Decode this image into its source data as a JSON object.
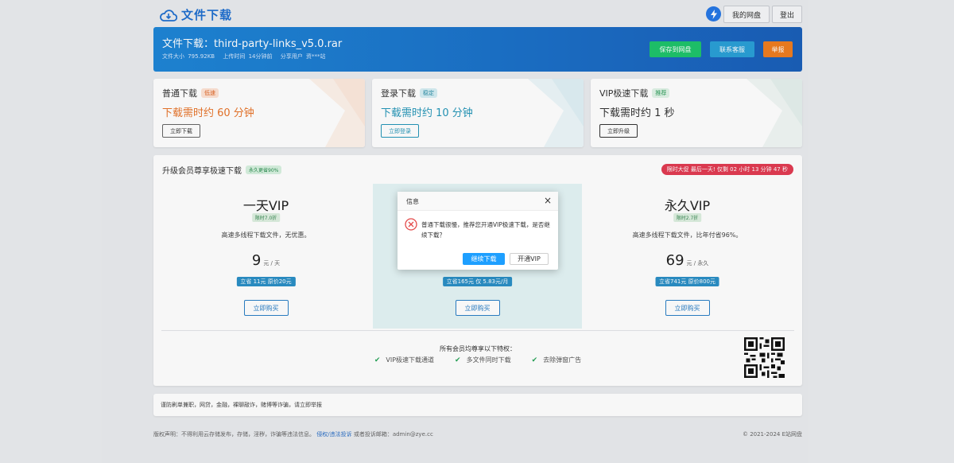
{
  "header": {
    "logo_text": "文件下载",
    "my_pan_label": "我的网盘",
    "logout_label": "登出"
  },
  "banner": {
    "title": "文件下载：third-party-links_v5.0.rar",
    "size": "文件大小 795.92KB",
    "upload_time": "上传时间 14分钟前",
    "sharer": "分享用户 资***站",
    "save_label": "保存到网盘",
    "service_label": "联系客服",
    "report_label": "举报"
  },
  "downloads": [
    {
      "title": "普通下载",
      "tag": "低速",
      "time": "下载需时约 60 分钟",
      "button": "立即下载",
      "time_color": "#e8742a"
    },
    {
      "title": "登录下载",
      "tag": "稳定",
      "time": "下载需时约 10 分钟",
      "button": "立即登录",
      "time_color": "#2596b8"
    },
    {
      "title": "VIP极速下载",
      "tag": "推荐",
      "time": "下载需时约 1 秒",
      "button": "立即升级",
      "time_color": "#333333"
    }
  ],
  "vip": {
    "heading": "升级会员尊享极速下载",
    "heading_tag": "永久更省90%",
    "promo": "限时大促 最后一天! 仅剩 02 小时 13 分钟 47 秒",
    "plans": [
      {
        "name": "一天VIP",
        "discount": "限时7.0折",
        "desc": "高速多线程下载文件，无优惠。",
        "price": "9",
        "unit": "元 / 天",
        "save": "立省 11元 原价20元",
        "buy": "立即购买"
      },
      {
        "name": "",
        "discount": "",
        "desc": "",
        "price": "",
        "unit": "",
        "save": "立省165元 仅 5.83元/月",
        "buy": "立即购买"
      },
      {
        "name": "永久VIP",
        "discount": "限时2.7折",
        "desc": "高速多线程下载文件，比年付省96%。",
        "price": "69",
        "unit": "元 / 永久",
        "save": "立省741元 原价800元",
        "buy": "立即购买"
      }
    ],
    "perks_title": "所有会员均尊享以下特权：",
    "perks": [
      "VIP极速下载通道",
      "多文件同时下载",
      "去除弹窗广告"
    ]
  },
  "notice": "谨防刷单兼职，网贷，金融，裸聊敲诈，赌博等诈骗，请立即举报",
  "footer": {
    "left": "版权声明：不得利用云存储发布，存储，淫秽，诈骗等违法信息。",
    "link": "侵权/违法投诉",
    "email": "或者投诉邮箱：admin@zye.cc",
    "right": "© 2021-2024 E站网盘"
  },
  "modal": {
    "title": "信息",
    "message": "普通下载很慢，推荐您开通VIP极速下载，是否继续下载？",
    "continue_label": "继续下载",
    "vip_label": "开通VIP"
  },
  "colors": {
    "brand": "#1f6fcf",
    "banner": "#1b6fc7",
    "save_green": "#1ec46b",
    "report_orange": "#ee7d20",
    "promo_red": "#e23b52",
    "confirm_blue": "#1e9fff"
  },
  "icons": {
    "logo": "cloud-download-icon",
    "bolt": "lightning-icon",
    "close": "close-icon",
    "error": "error-circle-icon",
    "check": "check-icon",
    "qr": "qr-code-icon"
  }
}
